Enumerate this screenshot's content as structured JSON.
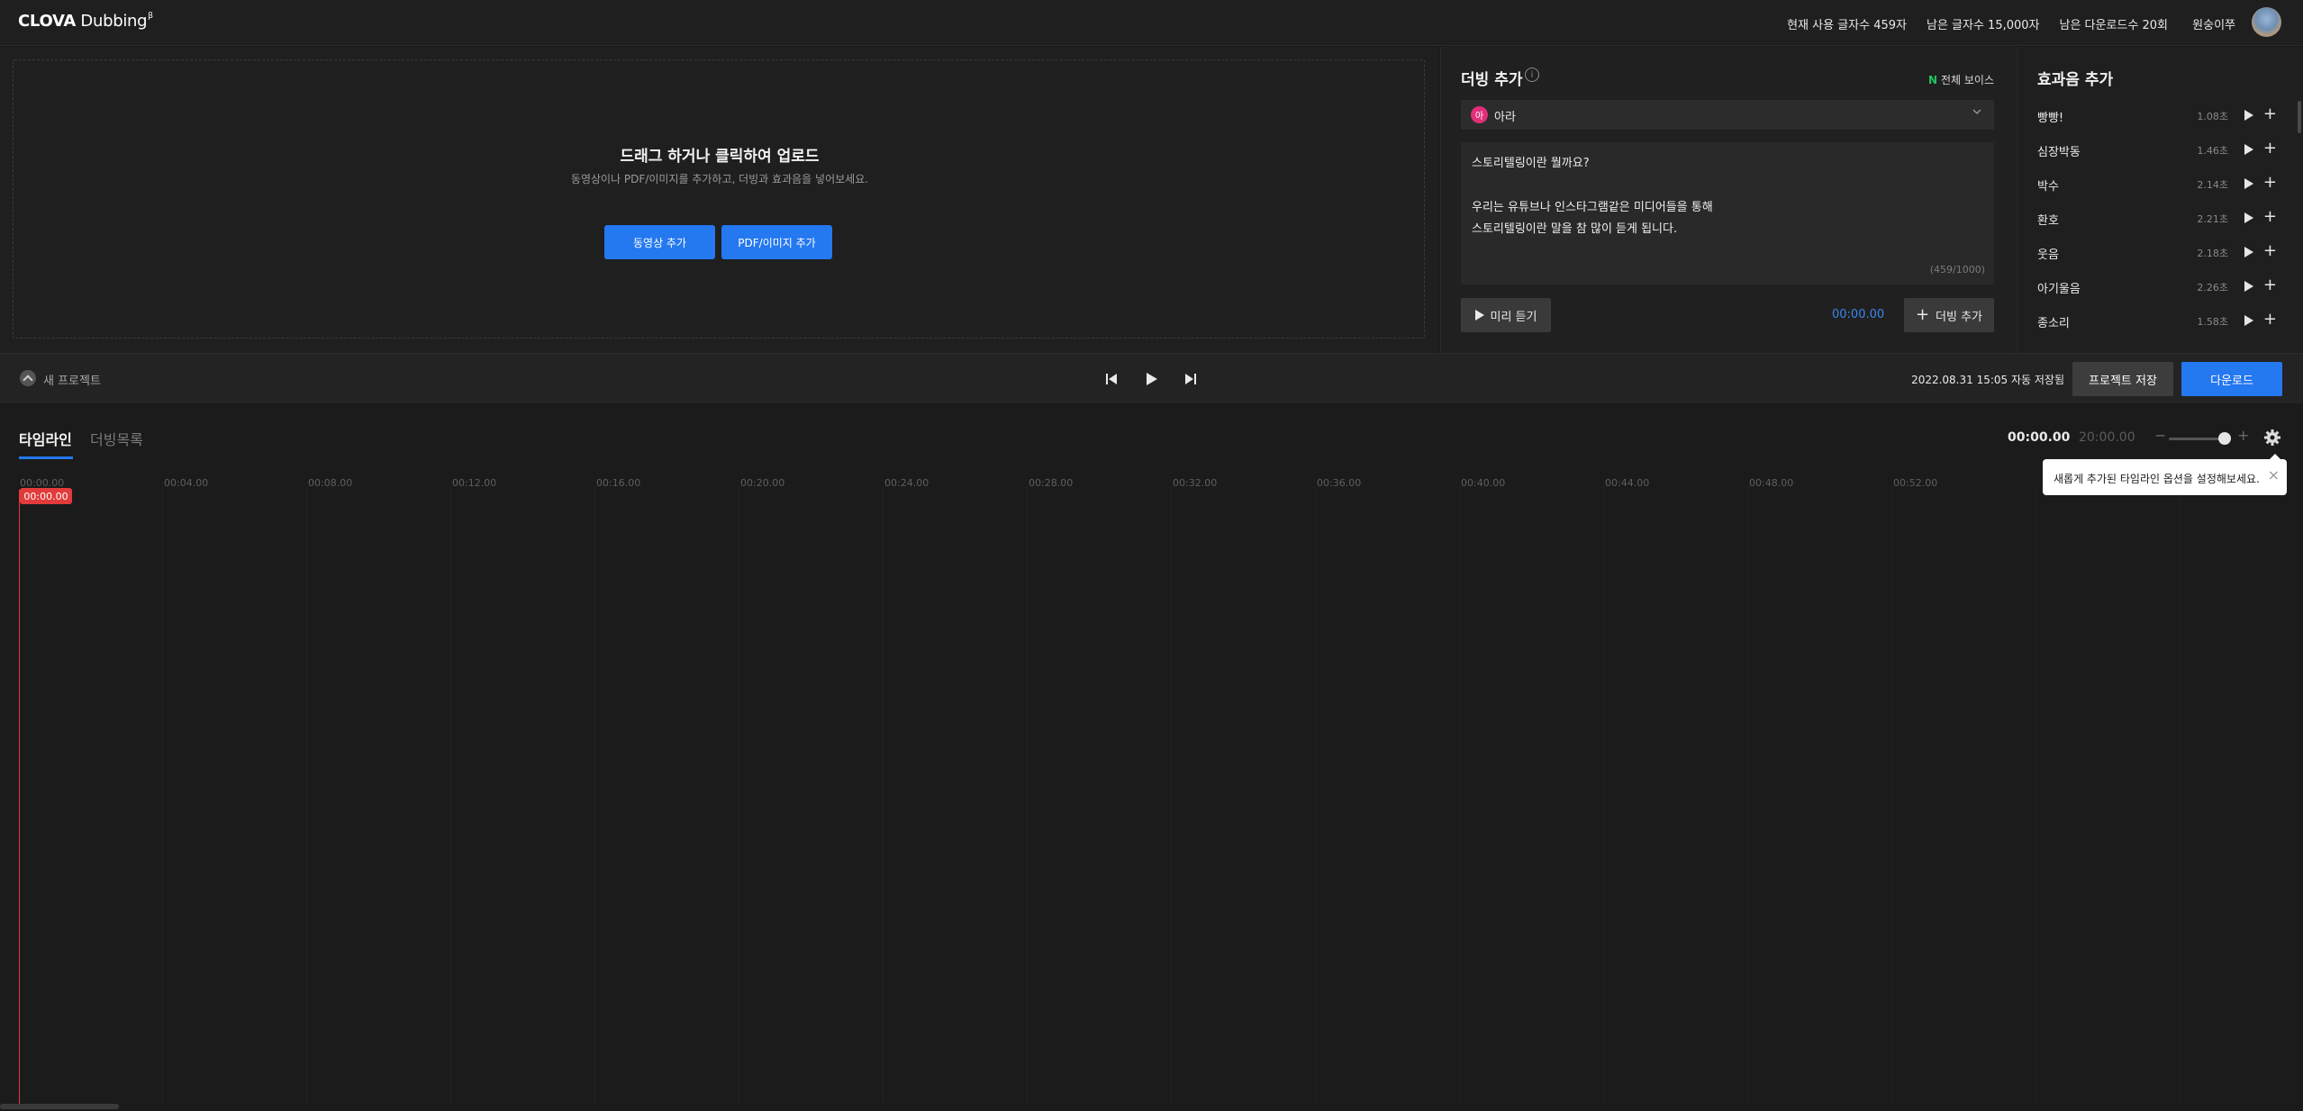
{
  "app": {
    "logo_brand": "CLOVA",
    "logo_product": "Dubbing",
    "logo_sup": "β"
  },
  "header": {
    "usage_current": "현재 사용 글자수 459자",
    "usage_remaining_chars": "남은 글자수 15,000자",
    "usage_remaining_downloads": "남은 다운로드수 20회",
    "username": "원숭이쭈"
  },
  "upload": {
    "title": "드래그 하거나 클릭하여 업로드",
    "subtitle": "동영상이나 PDF/이미지를 추가하고, 더빙과 효과음을 넣어보세요.",
    "add_video_label": "동영상 추가",
    "add_pdf_label": "PDF/이미지 추가"
  },
  "dubbing": {
    "title": "더빙 추가",
    "info_glyph": "i",
    "all_voices_badge": "N",
    "all_voices_label": "전체 보이스",
    "voice_badge": "아",
    "voice_name": "아라",
    "text_lines": [
      "스토리텔링이란 뭘까요?",
      "",
      "우리는 유튜브나 인스타그램같은 미디어들을 통해",
      "스토리텔링이란 말을 참 많이 듣게 됩니다."
    ],
    "char_count": "(459/1000)",
    "preview_label": "미리 듣기",
    "time": "00:00.00",
    "add_dub_label": "더빙 추가"
  },
  "sfx": {
    "title": "효과음 추가",
    "items": [
      {
        "name": "빵빵!",
        "duration": "1.08초"
      },
      {
        "name": "심장박동",
        "duration": "1.46초"
      },
      {
        "name": "박수",
        "duration": "2.14초"
      },
      {
        "name": "환호",
        "duration": "2.21초"
      },
      {
        "name": "웃음",
        "duration": "2.18초"
      },
      {
        "name": "아기울음",
        "duration": "2.26초"
      },
      {
        "name": "종소리",
        "duration": "1.58초"
      }
    ]
  },
  "transport": {
    "project_name": "새 프로젝트",
    "saved_status": "2022.08.31 15:05 자동 저장됨",
    "save_label": "프로젝트 저장",
    "download_label": "다운로드"
  },
  "timeline": {
    "tab_timeline": "타임라인",
    "tab_dublist": "더빙목록",
    "current_time": "00:00.00",
    "total_time": "20:00.00",
    "zoom_minus": "−",
    "zoom_plus": "+",
    "ticks": [
      "00:00.00",
      "00:04.00",
      "00:08.00",
      "00:12.00",
      "00:16.00",
      "00:20.00",
      "00:24.00",
      "00:28.00",
      "00:32.00",
      "00:36.00",
      "00:40.00",
      "00:44.00",
      "00:48.00",
      "00:52.00"
    ],
    "playhead_time": "00:00.00",
    "tooltip_text": "새롭게 추가된 타임라인 옵션을 설정해보세요.",
    "tooltip_close": "×"
  },
  "colors": {
    "accent": "#2478f0",
    "playhead": "#e23b3b",
    "new_badge": "#23c55e",
    "voice_badge": "#e0307a"
  }
}
